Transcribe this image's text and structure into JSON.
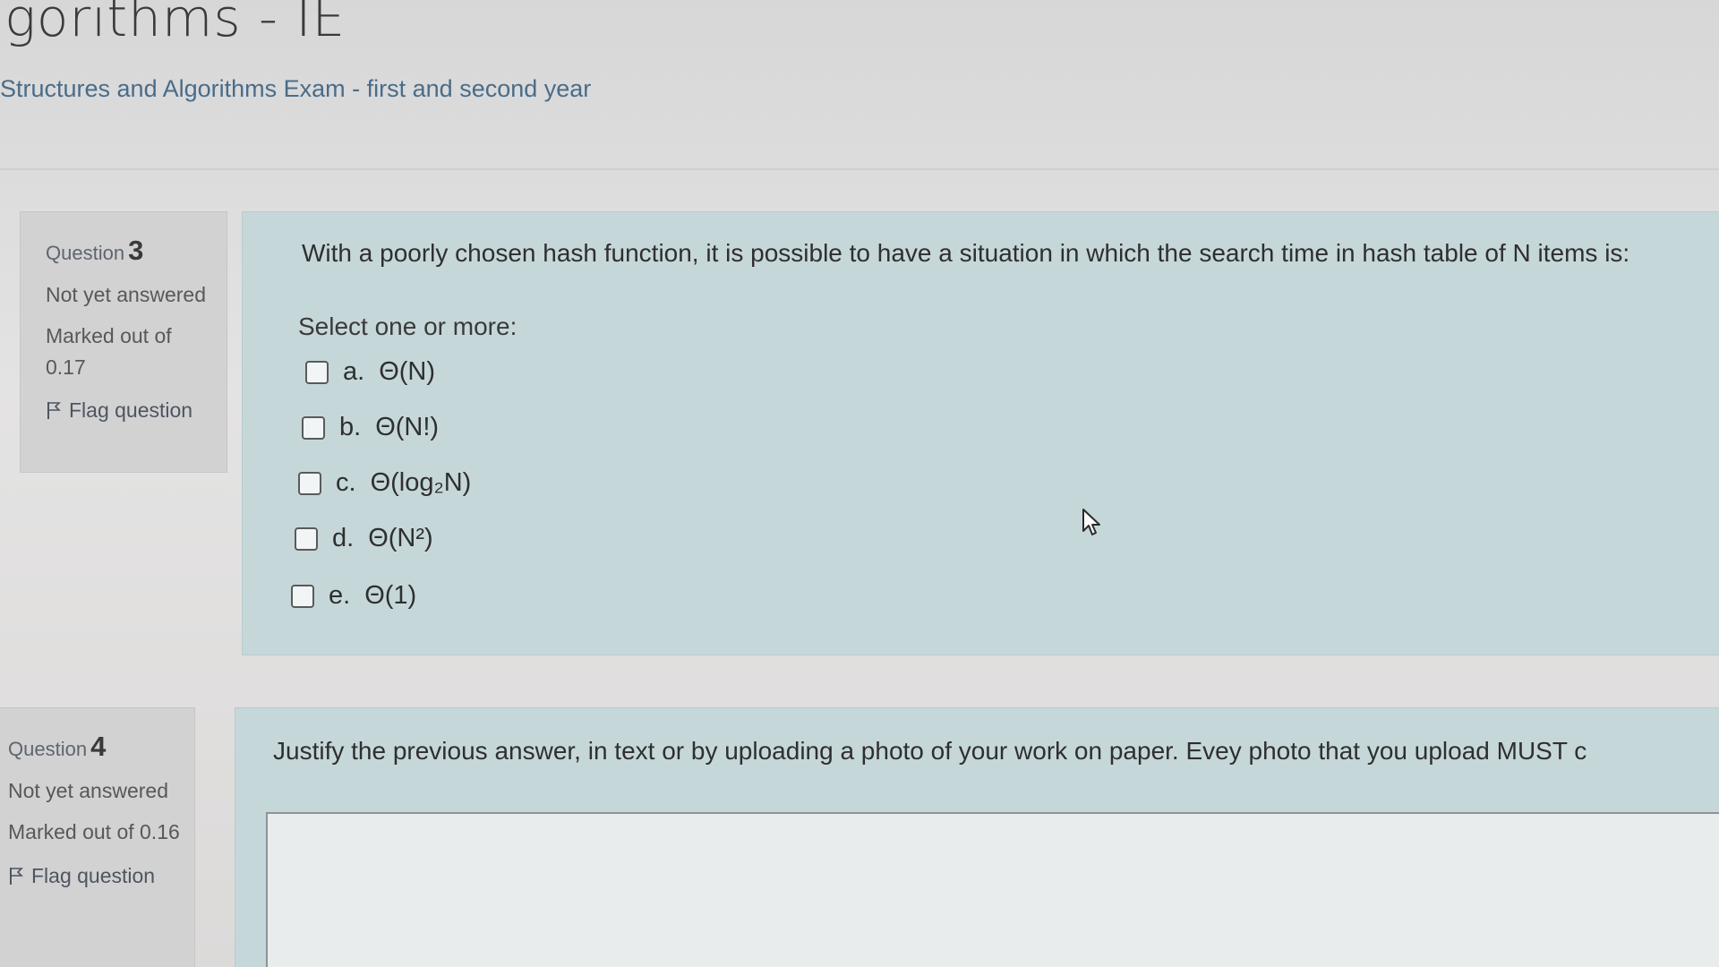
{
  "header": {
    "course_title": "lgorithms - IE",
    "breadcrumb": "Structures and Algorithms Exam - first and second year"
  },
  "questions": [
    {
      "label": "Question",
      "number": "3",
      "status": "Not yet answered",
      "marks": "Marked out of 0.17",
      "flag_label": "Flag question",
      "text": "With a poorly chosen hash function, it is possible to have a situation in which the search time in hash table of N items is:",
      "prompt": "Select one or more:",
      "options": [
        {
          "letter": "a.",
          "text": "Θ(N)",
          "checked": false
        },
        {
          "letter": "b.",
          "text": "Θ(N!)",
          "checked": false
        },
        {
          "letter": "c.",
          "text": "Θ(log₂N)",
          "checked": false
        },
        {
          "letter": "d.",
          "text": "Θ(N²)",
          "checked": false
        },
        {
          "letter": "e.",
          "text": "Θ(1)",
          "checked": false
        }
      ]
    },
    {
      "label": "Question",
      "number": "4",
      "status": "Not yet answered",
      "marks": "Marked out of 0.16",
      "flag_label": "Flag question",
      "text": "Justify the previous answer, in text or by uploading a photo of your work on paper. Evey photo that you upload MUST c"
    }
  ],
  "icons": {
    "flag": "flag-icon",
    "cursor": "mouse-pointer-icon"
  },
  "colors": {
    "info_box": "#d2d2d2",
    "content_box": "#c6d7da",
    "link": "#4a6c88"
  }
}
